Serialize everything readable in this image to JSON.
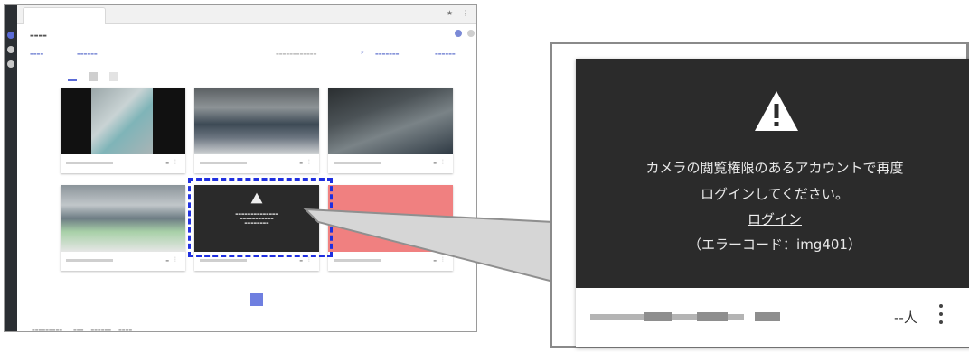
{
  "zoom": {
    "error_message_line1": "カメラの閲覧権限のあるアカウントで再度",
    "error_message_line2": "ログインしてください。",
    "login_link": "ログイン",
    "error_code": "（エラーコード：img401）",
    "viewer_count": "--人",
    "warning_icon": "warning-triangle-icon",
    "more_icon": "more-vertical-icon"
  },
  "colors": {
    "error_background": "#2b2b2b",
    "selection_highlight": "#1f2fe0",
    "accent": "#6f7fe0",
    "offline_tile": "#f08080"
  }
}
